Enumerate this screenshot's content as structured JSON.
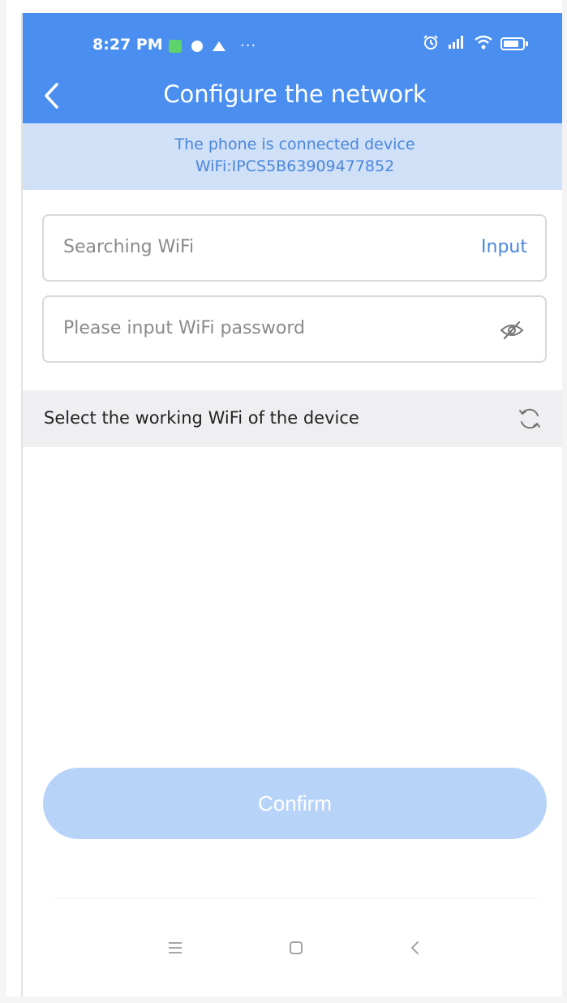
{
  "status_bar": {
    "time": "8:27 PM",
    "more": "···",
    "battery_level": 0.8
  },
  "nav": {
    "title": "Configure the network"
  },
  "banner": {
    "line1": "The phone is connected device",
    "line2": "WiFi:IPCS5B63909477852"
  },
  "wifi_field": {
    "value": "Searching WiFi",
    "action_label": "Input"
  },
  "password_field": {
    "placeholder": "Please input WiFi password"
  },
  "section": {
    "title": "Select the working WiFi of the device"
  },
  "confirm": {
    "label": "Confirm",
    "enabled": false
  },
  "colors": {
    "header": "#4a8ff0",
    "banner_bg": "#cfe0f7",
    "accent_text": "#4a86dc",
    "confirm_disabled": "#b8d3f8"
  },
  "icons": {
    "back": "chevron-left-icon",
    "eye": "eye-off-icon",
    "refresh": "refresh-icon",
    "sys_menu": "menu-icon",
    "sys_home": "home-square-icon",
    "sys_back": "back-triangle-icon"
  }
}
